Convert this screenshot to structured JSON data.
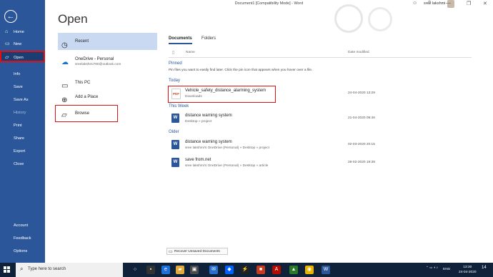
{
  "window": {
    "title": "Document1 [Compatibility Mode]  -  Word",
    "user": "sree lakshmi",
    "controls": {
      "emoji": "☺",
      "help": "?",
      "minimize": "—",
      "restore": "❐",
      "close": "✕"
    }
  },
  "sidebar": {
    "back_glyph": "←",
    "items": [
      {
        "label": "Home",
        "icon": "⌂"
      },
      {
        "label": "New",
        "icon": "▭"
      },
      {
        "label": "Open",
        "icon": "▱"
      },
      {
        "label": "Info"
      },
      {
        "label": "Save"
      },
      {
        "label": "Save As"
      },
      {
        "label": "History"
      },
      {
        "label": "Print"
      },
      {
        "label": "Share"
      },
      {
        "label": "Export"
      },
      {
        "label": "Close"
      }
    ],
    "bottom": [
      {
        "label": "Account"
      },
      {
        "label": "Feedback"
      },
      {
        "label": "Options"
      }
    ]
  },
  "heading": "Open",
  "locations": {
    "recent": {
      "label": "Recent",
      "icon": "◷"
    },
    "onedrive": {
      "label": "OneDrive - Personal",
      "email": "sreelakshmi780@outlook.com",
      "icon": "☁"
    },
    "this_pc": {
      "label": "This PC",
      "icon": "▭"
    },
    "add_place": {
      "label": "Add a Place",
      "icon": "⊕"
    },
    "browse": {
      "label": "Browse",
      "icon": "▱"
    }
  },
  "tabs": {
    "documents": "Documents",
    "folders": "Folders"
  },
  "columns": {
    "name": "Name",
    "date": "Date modified"
  },
  "sections": {
    "pinned": "Pinned",
    "today": "Today",
    "this_week": "This Week",
    "older": "Older"
  },
  "pinned_note": "Pin files you want to easily find later. Click the pin icon that appears when you hover over a file.",
  "files": [
    {
      "name": "Vehicle_safety_distance_alarming_system",
      "path": "Downloads",
      "date": "24-04-2020 13:29",
      "type": "pdf"
    },
    {
      "name": "distance warning system",
      "path": "Desktop » project",
      "date": "21-04-2020 09:46",
      "type": "word"
    },
    {
      "name": "distance warning system",
      "path": "sree lakshmi's OneDrive (Personal) » Desktop » project",
      "date": "02-03-2020 20:15",
      "type": "word"
    },
    {
      "name": "save from.net",
      "path": "sree lakshmi's OneDrive (Personal) » Desktop » article",
      "date": "28-02-2020 19:39",
      "type": "word"
    }
  ],
  "file_icons": {
    "pdf": "PDF",
    "word": "W"
  },
  "recover_button": "Recover Unsaved Documents",
  "taskbar": {
    "search_placeholder": "Type here to search",
    "lang": "ENG",
    "time": "13:30",
    "date": "24-04-2020",
    "notifications": "14"
  }
}
